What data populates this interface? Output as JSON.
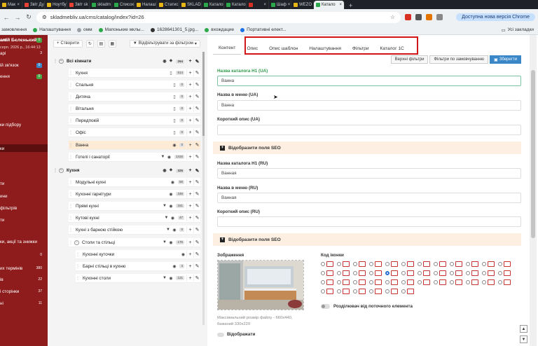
{
  "browser": {
    "tabs": [
      {
        "label": "Мак",
        "color": "#e8b517"
      },
      {
        "label": "Звіт Ду",
        "color": "#e84235"
      },
      {
        "label": "Ноутбу",
        "color": "#e8b517"
      },
      {
        "label": "Звіт sk",
        "color": "#e84235"
      },
      {
        "label": "skladm",
        "color": "#2aa84a"
      },
      {
        "label": "Список",
        "color": "#2aa84a"
      },
      {
        "label": "Налашт",
        "color": "#e8b517"
      },
      {
        "label": "Статис",
        "color": "#e8b517"
      },
      {
        "label": "SKLAD",
        "color": "#e8b517"
      },
      {
        "label": "Катало",
        "color": "#2aa84a"
      },
      {
        "label": "Катало",
        "color": "#2aa84a"
      },
      {
        "label": "",
        "color": "#d93025"
      },
      {
        "label": "Шаф",
        "color": "#2aa84a"
      },
      {
        "label": "WEZO",
        "color": "#e8b517"
      },
      {
        "label": "Катало",
        "color": "#2aa84a"
      }
    ],
    "url": "skladmebliv.ua/cms/catalog/index?id=26",
    "update_chip": "Доступна нова версія Chrome",
    "bookmarks": [
      {
        "label": "замовлення",
        "color": ""
      },
      {
        "label": "Налаштування",
        "color": "#2aa84a"
      },
      {
        "label": "омм",
        "color": "#9aa0a6"
      },
      {
        "label": "Мапонькие мклы...",
        "color": "#2aa84a"
      },
      {
        "label": "1628641301_5.jpg...",
        "color": "#333333"
      },
      {
        "label": "вхождацие",
        "color": "#2aa84a"
      },
      {
        "label": "Портативні елект...",
        "color": "#1a73e8"
      }
    ],
    "bookmarks_all": "Усі закладки"
  },
  "sidebar": {
    "user": "алій Бєлєнький",
    "date": "серп. 2026 р., 16:44:13",
    "items": [
      {
        "label": "ord",
        "badge": "0",
        "badge_color": "#47a447"
      },
      {
        "label": "арі",
        "badge": "3",
        "badge_color": ""
      },
      {
        "label": "ій зв'язок",
        "badge": "0",
        "badge_color": "#3a87c8"
      },
      {
        "label": "ення",
        "badge": "0",
        "badge_color": "#47a447"
      },
      {
        "label": "ки підбору",
        "badge": "",
        "badge_color": ""
      },
      {
        "label": "ки",
        "badge": "",
        "badge_color": ""
      },
      {
        "label": "ти",
        "badge": "",
        "badge_color": ""
      },
      {
        "label": "ини",
        "badge": "",
        "badge_color": ""
      },
      {
        "label": "фільтрів",
        "badge": "",
        "badge_color": ""
      },
      {
        "label": "ти",
        "badge": "",
        "badge_color": ""
      },
      {
        "label": "ки, акції та знижки",
        "badge": "",
        "badge_color": ""
      },
      {
        "label": "",
        "badge": "0",
        "badge_color": ""
      },
      {
        "label": "их термінів",
        "badge": "380",
        "badge_color": ""
      },
      {
        "label": "ів",
        "badge": "22",
        "badge_color": ""
      },
      {
        "label": "і сторінки",
        "badge": "37",
        "badge_color": ""
      },
      {
        "label": "ні",
        "badge": "11",
        "badge_color": ""
      }
    ]
  },
  "tree": {
    "toolbar": {
      "create": "Створити",
      "filter": "Відфільтрувати за фільтром"
    },
    "rows": [
      {
        "name": "Всі кімнати",
        "count": "264",
        "level": 0
      },
      {
        "name": "Кухня",
        "count": "514",
        "level": 1
      },
      {
        "name": "Спальня",
        "count": "0",
        "level": 1
      },
      {
        "name": "Дитяча",
        "count": "0",
        "level": 1
      },
      {
        "name": "Вітальня",
        "count": "0",
        "level": 1
      },
      {
        "name": "Передпокій",
        "count": "0",
        "level": 1
      },
      {
        "name": "Офіс",
        "count": "0",
        "level": 1
      },
      {
        "name": "Ванна",
        "count": "0",
        "level": 1
      },
      {
        "name": "Готелі і санаторії",
        "count": "1416",
        "level": 1
      },
      {
        "name": "Кухня",
        "count": "326",
        "level": 0
      },
      {
        "name": "Модульні кухні",
        "count": "56",
        "level": 1
      },
      {
        "name": "Кухонні гарнітури",
        "count": "246",
        "level": 1
      },
      {
        "name": "Прямі кухні",
        "count": "151",
        "level": 1
      },
      {
        "name": "Кутові кухні",
        "count": "47",
        "level": 1
      },
      {
        "name": "Кухні з барною стійкою",
        "count": "0",
        "level": 1
      },
      {
        "name": "Столи та стільці",
        "count": "176",
        "level": 1
      },
      {
        "name": "Кухонні куточки",
        "count": "",
        "level": 2
      },
      {
        "name": "Барні стільці в кухню",
        "count": "4",
        "level": 2
      },
      {
        "name": "Кухонні столи",
        "count": "121",
        "level": 2
      }
    ]
  },
  "content": {
    "tabs": [
      "Контент",
      "Опис",
      "Опис шаблон",
      "Налаштування",
      "Фільтри",
      "Каталог 1С"
    ],
    "sub_buttons": {
      "top_filters": "Верхні фільтри",
      "default_filters": "Фільтри по замовчуванню",
      "save": "Зберегти"
    },
    "fields": {
      "h1_ua_label": "Назва каталога H1 (UA)",
      "h1_ua_value": "Ванна",
      "menu_ua_label": "Назва в меню (UA)",
      "menu_ua_value": "Ванна",
      "short_ua_label": "Короткий опис (UA)",
      "short_ua_value": "",
      "seo_toggle": "Відобразити поля SEO",
      "h1_ru_label": "Назва каталога H1 (RU)",
      "h1_ru_value": "Ванная",
      "menu_ru_label": "Назва в меню (RU)",
      "menu_ru_value": "Ванная",
      "short_ru_label": "Короткий опис (RU)",
      "short_ru_value": "",
      "seo_toggle_2": "Відобразити поля SEO"
    },
    "image": {
      "label": "Зображення",
      "hint": "Максимальний розмір файлу - 660x440, бажаний 330x220",
      "display_label": "Відображати"
    },
    "icon_code": {
      "label": "Код іконки",
      "separate_label": "Розділювач від поточного елемента"
    }
  }
}
